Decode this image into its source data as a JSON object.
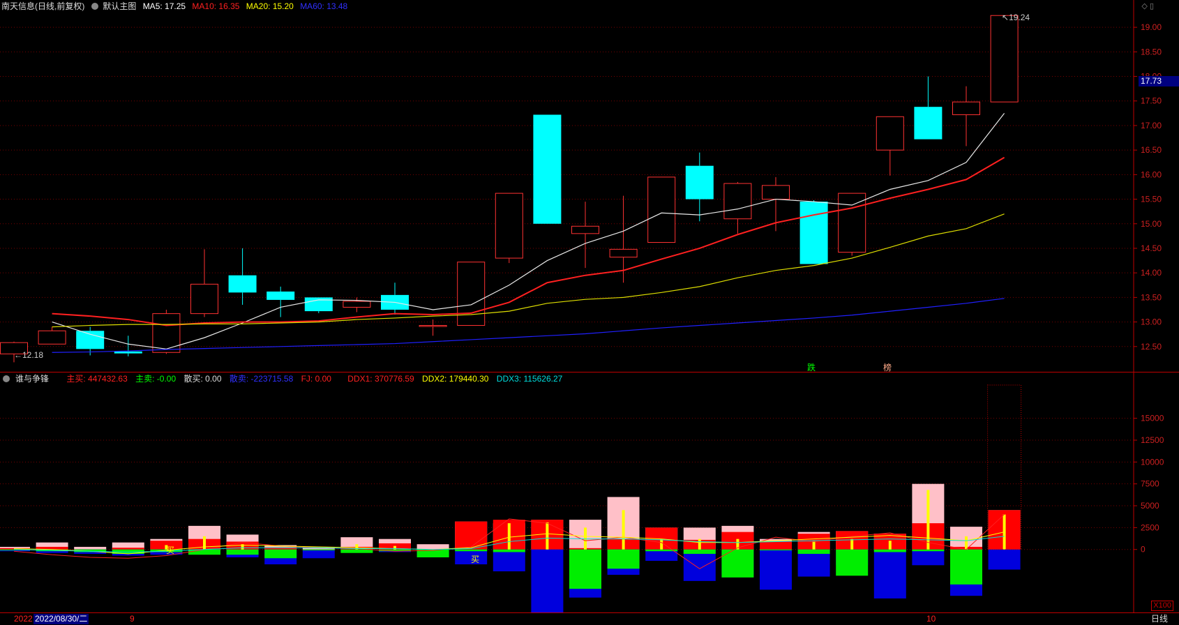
{
  "header": {
    "stock": "南天信息(日线,前复权)",
    "main_label": "默认主图",
    "ma5": "MA5: 17.25",
    "ma10": "MA10: 16.35",
    "ma20": "MA20: 15.20",
    "ma60": "MA60: 13.48",
    "colors": {
      "ma5": "#ffffff",
      "ma10": "#ff2020",
      "ma20": "#ffff00",
      "ma60": "#2020ff"
    }
  },
  "indicator": {
    "name": "谁与争锋",
    "zhumai": "主买: 447432.63",
    "zhumai_s": "主卖: -0.00",
    "sanmai": "散买: 0.00",
    "sanmai_s": "散卖: -223715.58",
    "fj": "FJ: 0.00",
    "ddx1": "DDX1: 370776.59",
    "ddx2": "DDX2: 179440.30",
    "ddx3": "DDX3: 115626.27"
  },
  "current_price": "17.73",
  "high_label": "19.24",
  "low_label": "12.18",
  "markers": {
    "die": "跌",
    "bang": "榜",
    "mai1": "买",
    "mai2": "买"
  },
  "footer": {
    "year": "2022",
    "date": "2022/08/30/二",
    "m9": "9",
    "m10": "10",
    "period": "日线",
    "scale": "X100"
  },
  "icons": [
    "diamond-icon",
    "window-icon"
  ],
  "chart_data": [
    {
      "type": "candlestick",
      "title": "南天信息(日线,前复权)",
      "ylim": [
        12.0,
        19.3
      ],
      "y_ticks": [
        "12.50",
        "13.00",
        "13.50",
        "14.00",
        "14.50",
        "15.00",
        "15.50",
        "16.00",
        "16.50",
        "17.00",
        "17.50",
        "18.00",
        "18.50",
        "19.00"
      ],
      "candles": [
        {
          "o": 12.35,
          "h": 12.6,
          "l": 12.18,
          "c": 12.58
        },
        {
          "o": 12.55,
          "h": 12.9,
          "l": 12.55,
          "c": 12.82
        },
        {
          "o": 12.82,
          "h": 12.9,
          "l": 12.32,
          "c": 12.45
        },
        {
          "o": 12.4,
          "h": 12.72,
          "l": 12.3,
          "c": 12.36
        },
        {
          "o": 12.38,
          "h": 13.25,
          "l": 12.35,
          "c": 13.17
        },
        {
          "o": 13.17,
          "h": 14.48,
          "l": 13.1,
          "c": 13.77
        },
        {
          "o": 13.95,
          "h": 14.5,
          "l": 13.35,
          "c": 13.6
        },
        {
          "o": 13.62,
          "h": 13.72,
          "l": 13.1,
          "c": 13.45
        },
        {
          "o": 13.5,
          "h": 13.5,
          "l": 13.18,
          "c": 13.22
        },
        {
          "o": 13.3,
          "h": 13.5,
          "l": 13.2,
          "c": 13.42
        },
        {
          "o": 13.55,
          "h": 13.8,
          "l": 13.15,
          "c": 13.25
        },
        {
          "o": 12.93,
          "h": 13.05,
          "l": 12.72,
          "c": 12.93
        },
        {
          "o": 12.93,
          "h": 14.22,
          "l": 12.93,
          "c": 14.22
        },
        {
          "o": 14.3,
          "h": 15.62,
          "l": 14.2,
          "c": 15.62
        },
        {
          "o": 17.22,
          "h": 17.22,
          "l": 15.0,
          "c": 15.0
        },
        {
          "o": 14.8,
          "h": 15.45,
          "l": 14.1,
          "c": 14.95
        },
        {
          "o": 14.32,
          "h": 15.57,
          "l": 13.8,
          "c": 14.48
        },
        {
          "o": 14.62,
          "h": 15.95,
          "l": 14.62,
          "c": 15.95
        },
        {
          "o": 16.18,
          "h": 16.45,
          "l": 15.05,
          "c": 15.5
        },
        {
          "o": 15.1,
          "h": 15.85,
          "l": 14.8,
          "c": 15.82
        },
        {
          "o": 15.5,
          "h": 15.95,
          "l": 14.85,
          "c": 15.78
        },
        {
          "o": 15.45,
          "h": 15.48,
          "l": 14.18,
          "c": 14.18
        },
        {
          "o": 14.42,
          "h": 15.62,
          "l": 14.35,
          "c": 15.62
        },
        {
          "o": 16.5,
          "h": 17.18,
          "l": 15.98,
          "c": 17.18
        },
        {
          "o": 17.38,
          "h": 18.0,
          "l": 16.72,
          "c": 16.72
        },
        {
          "o": 17.22,
          "h": 17.8,
          "l": 16.58,
          "c": 17.48
        },
        {
          "o": 17.48,
          "h": 19.24,
          "l": 17.48,
          "c": 19.24
        }
      ],
      "series": [
        {
          "name": "MA5",
          "values": [
            13.0,
            12.75,
            12.55,
            12.45,
            12.68,
            12.98,
            13.3,
            13.45,
            13.44,
            13.4,
            13.25,
            13.35,
            13.75,
            14.25,
            14.6,
            14.85,
            15.22,
            15.18,
            15.3,
            15.5,
            15.45,
            15.38,
            15.7,
            15.88,
            16.25,
            17.25
          ]
        },
        {
          "name": "MA10",
          "values": [
            13.17,
            13.12,
            13.05,
            12.93,
            12.98,
            13.0,
            13.0,
            13.02,
            13.1,
            13.17,
            13.15,
            13.18,
            13.4,
            13.8,
            13.95,
            14.05,
            14.28,
            14.5,
            14.78,
            15.02,
            15.18,
            15.32,
            15.52,
            15.7,
            15.9,
            16.35
          ]
        },
        {
          "name": "MA20",
          "values": [
            12.9,
            12.93,
            12.95,
            12.95,
            12.96,
            12.96,
            12.98,
            13.0,
            13.05,
            13.08,
            13.12,
            13.15,
            13.22,
            13.38,
            13.46,
            13.5,
            13.6,
            13.72,
            13.9,
            14.05,
            14.15,
            14.3,
            14.52,
            14.75,
            14.9,
            15.2
          ]
        },
        {
          "name": "MA60",
          "values": [
            12.38,
            12.39,
            12.41,
            12.44,
            12.46,
            12.48,
            12.5,
            12.52,
            12.54,
            12.56,
            12.6,
            12.64,
            12.68,
            12.72,
            12.76,
            12.82,
            12.88,
            12.93,
            12.98,
            13.03,
            13.08,
            13.14,
            13.22,
            13.3,
            13.38,
            13.48
          ]
        }
      ]
    },
    {
      "type": "bar",
      "title": "谁与争锋",
      "ylim": [
        -7200,
        18800
      ],
      "y_ticks": [
        "0",
        "2500",
        "5000",
        "7500",
        "10000",
        "12500",
        "15000"
      ],
      "pink": [
        300,
        800,
        300,
        800,
        1200,
        2700,
        1700,
        500,
        300,
        1400,
        1200,
        600,
        3200,
        3000,
        3400,
        3400,
        6000,
        2500,
        2500,
        2700,
        1200,
        2000,
        2100,
        1800,
        7500,
        2600,
        4500
      ],
      "red": [
        150,
        300,
        0,
        200,
        1000,
        1200,
        900,
        250,
        0,
        300,
        700,
        0,
        3200,
        3400,
        3400,
        150,
        1200,
        2500,
        1100,
        2000,
        900,
        1800,
        2100,
        1800,
        3000,
        300,
        4500
      ],
      "yellow": [
        0,
        0,
        0,
        0,
        500,
        1500,
        600,
        0,
        0,
        600,
        400,
        0,
        0,
        3000,
        3100,
        2500,
        4500,
        1200,
        1200,
        1200,
        0,
        1000,
        1200,
        1000,
        6800,
        1500,
        4000
      ],
      "green": [
        -100,
        -200,
        -300,
        -500,
        -300,
        -600,
        -600,
        -1000,
        -100,
        -400,
        -200,
        -900,
        -200,
        -300,
        0,
        -4500,
        -2200,
        -200,
        -500,
        -3200,
        -100,
        -500,
        -3000,
        -300,
        -200,
        -4000,
        0
      ],
      "blue": [
        -200,
        -400,
        -500,
        -700,
        -600,
        -400,
        -900,
        -1700,
        -1000,
        -300,
        -300,
        -800,
        -1700,
        -2500,
        -7200,
        -5500,
        -2900,
        -1300,
        -3600,
        -2900,
        -4600,
        -3100,
        -1800,
        -5600,
        -1800,
        -5300,
        -2300
      ],
      "lines": [
        {
          "name": "DDX1",
          "values": [
            -200,
            -600,
            -900,
            -1000,
            -700,
            0,
            800,
            400,
            200,
            100,
            -200,
            -100,
            300,
            3500,
            3000,
            1000,
            1400,
            800,
            -2200,
            200,
            1400,
            900,
            1500,
            1900,
            800,
            0,
            4000
          ]
        },
        {
          "name": "DDX2",
          "values": [
            100,
            0,
            -200,
            -500,
            -100,
            300,
            500,
            400,
            300,
            200,
            100,
            0,
            200,
            1400,
            1800,
            1500,
            1400,
            1200,
            800,
            800,
            1000,
            1200,
            1400,
            1600,
            1300,
            1000,
            2000
          ]
        },
        {
          "name": "DDX3",
          "values": [
            0,
            -100,
            -200,
            -300,
            -200,
            0,
            200,
            200,
            200,
            100,
            100,
            0,
            100,
            900,
            1300,
            1200,
            1200,
            1100,
            900,
            800,
            900,
            1000,
            1100,
            1200,
            1100,
            1000,
            1500
          ]
        }
      ]
    }
  ]
}
